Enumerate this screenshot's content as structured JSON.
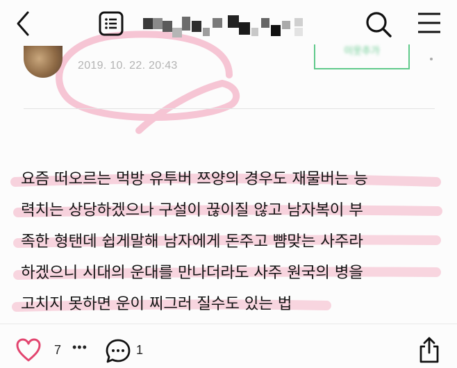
{
  "header": {
    "back_icon": "chevron-left-icon",
    "list_icon": "list-icon",
    "search_icon": "search-icon",
    "menu_icon": "hamburger-menu-icon"
  },
  "post": {
    "date": "2019. 10. 22. 20:43",
    "follow_label": "이웃추가",
    "accent_color": "#5fc98a",
    "body_lines": [
      "요즘 떠오르는 먹방 유투버 쯔양의 경우도 재물버는 능",
      "력치는 상당하겠으나 구설이 끊이질 않고 남자복이 부",
      "족한 형탠데 쉽게말해 남자에게 돈주고 뺨맞는 사주라",
      "하겠으니 시대의 운대를 만나더라도 사주 원국의 병을",
      "고치지 못하면 운이 찌그러 질수도 있는 법"
    ],
    "highlight_color": "#f2a8bf"
  },
  "actions": {
    "like_count": "7",
    "likers_more": "•••",
    "comment_count": "1",
    "like_icon": "heart-icon",
    "comment_icon": "comment-bubble-icon",
    "share_icon": "share-icon",
    "like_color": "#e2456f"
  }
}
